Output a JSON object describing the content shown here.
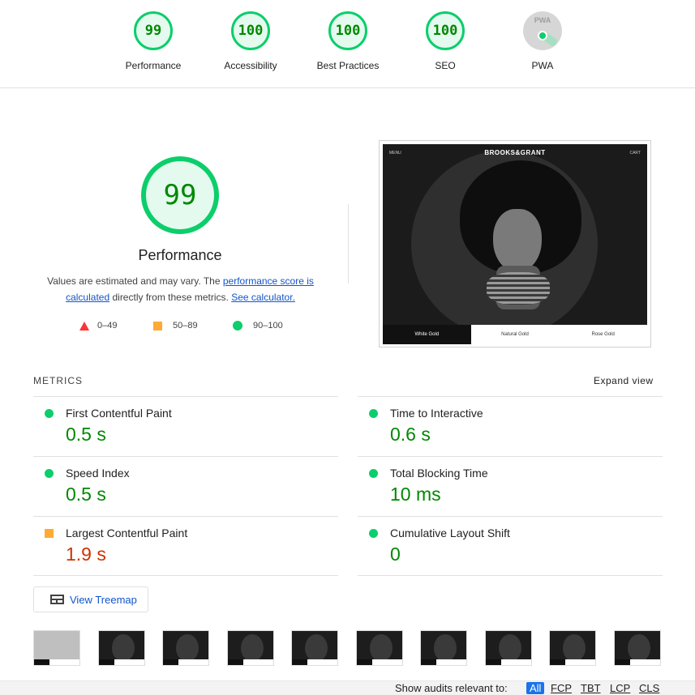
{
  "gauges": [
    {
      "score": "99",
      "label": "Performance"
    },
    {
      "score": "100",
      "label": "Accessibility"
    },
    {
      "score": "100",
      "label": "Best Practices"
    },
    {
      "score": "100",
      "label": "SEO"
    },
    {
      "score": "PWA",
      "label": "PWA"
    }
  ],
  "performance": {
    "score": "99",
    "title": "Performance",
    "desc_prefix": "Values are estimated and may vary. The ",
    "desc_link1": "performance score is calculated",
    "desc_mid": " directly from these metrics. ",
    "desc_link2": "See calculator.",
    "legend": {
      "fail": "0–49",
      "average": "50–89",
      "pass": "90–100"
    }
  },
  "screenshot": {
    "brand": "BROOKS&GRANT",
    "menu": "MENU",
    "cart": "CART",
    "tabs": [
      "White Gold",
      "Natural Gold",
      "Rose Gold"
    ]
  },
  "metrics": {
    "label": "METRICS",
    "expand": "Expand view",
    "items": [
      {
        "title": "First Contentful Paint",
        "value": "0.5 s"
      },
      {
        "title": "Time to Interactive",
        "value": "0.6 s"
      },
      {
        "title": "Speed Index",
        "value": "0.5 s"
      },
      {
        "title": "Total Blocking Time",
        "value": "10 ms"
      },
      {
        "title": "Largest Contentful Paint",
        "value": "1.9 s"
      },
      {
        "title": "Cumulative Layout Shift",
        "value": "0"
      }
    ]
  },
  "treemap": {
    "label": "View Treemap"
  },
  "filter": {
    "label": "Show audits relevant to:",
    "options": [
      "All",
      "FCP",
      "TBT",
      "LCP",
      "CLS"
    ]
  },
  "colors": {
    "pass": "#0cce6b",
    "average": "#ffaa33",
    "fail": "#ff3333",
    "link": "#1155cc"
  }
}
